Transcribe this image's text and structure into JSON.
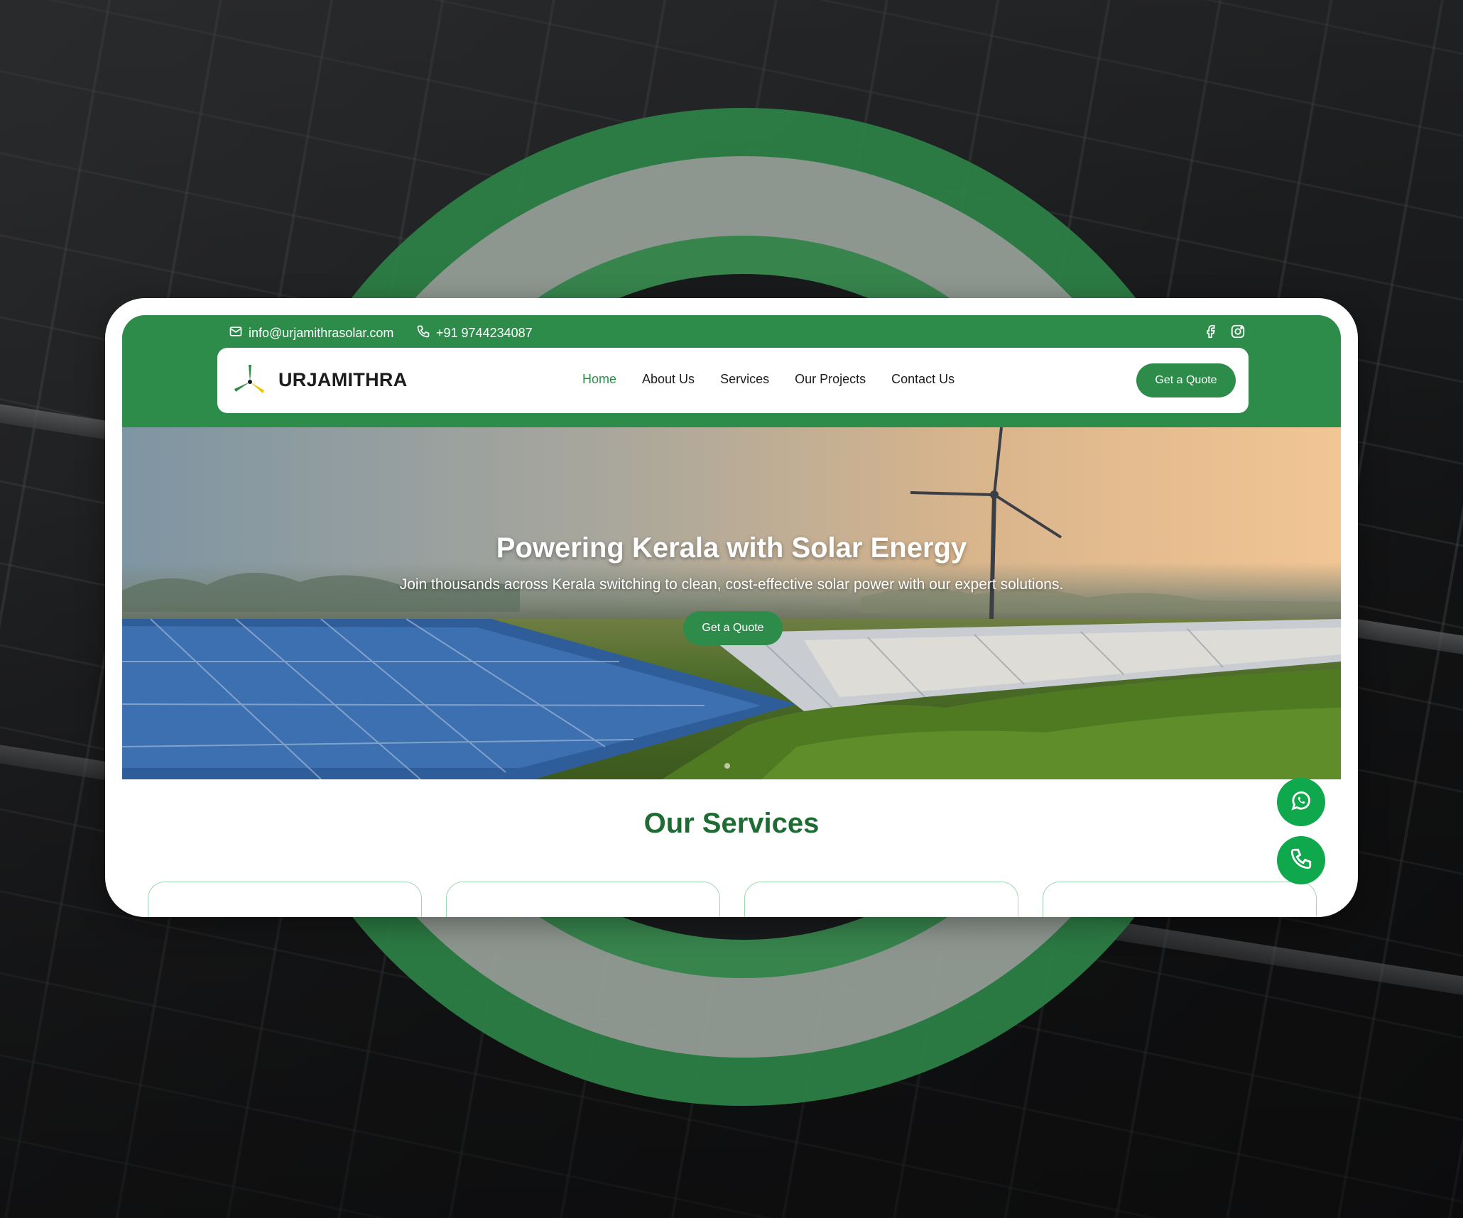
{
  "topbar": {
    "email": "info@urjamithrasolar.com",
    "phone": "+91 9744234087",
    "social": [
      "facebook-icon",
      "instagram-icon"
    ]
  },
  "navbar": {
    "brand": "URJAMITHRA",
    "items": [
      {
        "label": "Home",
        "active": true
      },
      {
        "label": "About Us",
        "active": false
      },
      {
        "label": "Services",
        "active": false
      },
      {
        "label": "Our Projects",
        "active": false
      },
      {
        "label": "Contact Us",
        "active": false
      }
    ],
    "cta": "Get a Quote"
  },
  "hero": {
    "title": "Powering Kerala with Solar Energy",
    "subtitle": "Join thousands across Kerala switching to clean, cost-effective solar power with our expert solutions.",
    "cta": "Get a Quote"
  },
  "services": {
    "title": "Our Services"
  },
  "floating": [
    "whatsapp-icon",
    "phone-icon"
  ],
  "colors": {
    "primary": "#2e8c4b",
    "heading": "#1e6b33",
    "fab": "#0fa84c"
  }
}
